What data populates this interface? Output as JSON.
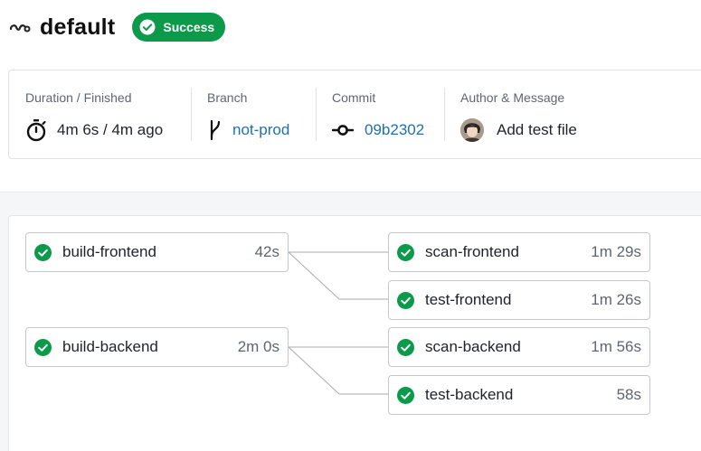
{
  "header": {
    "title": "default",
    "status": "Success"
  },
  "info": {
    "duration": {
      "label": "Duration / Finished",
      "value": "4m 6s / 4m ago"
    },
    "branch": {
      "label": "Branch",
      "value": "not-prod"
    },
    "commit": {
      "label": "Commit",
      "value": "09b2302"
    },
    "author": {
      "label": "Author & Message",
      "message": "Add test file"
    }
  },
  "jobs": {
    "build_frontend": {
      "name": "build-frontend",
      "duration": "42s"
    },
    "scan_frontend": {
      "name": "scan-frontend",
      "duration": "1m 29s"
    },
    "test_frontend": {
      "name": "test-frontend",
      "duration": "1m 26s"
    },
    "build_backend": {
      "name": "build-backend",
      "duration": "2m 0s"
    },
    "scan_backend": {
      "name": "scan-backend",
      "duration": "1m 56s"
    },
    "test_backend": {
      "name": "test-backend",
      "duration": "58s"
    }
  },
  "colors": {
    "success": "#0b9a4a",
    "link": "#1f6fb2"
  },
  "icons": {
    "pipeline": "pipeline-icon",
    "status": "check-circle-icon",
    "duration": "stopwatch-icon",
    "branch": "git-branch-icon",
    "commit": "git-commit-icon"
  }
}
